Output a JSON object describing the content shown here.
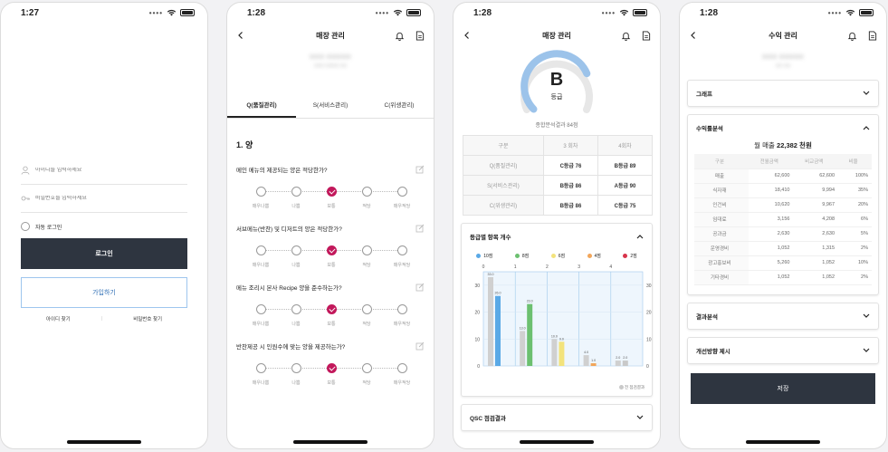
{
  "status": {
    "time1": "1:27",
    "time2": "1:28",
    "time3": "1:28",
    "time4": "1:28"
  },
  "login": {
    "id_placeholder": "아이디를 입력하세요",
    "pw_placeholder": "비밀번호를 입력하세요",
    "auto_login": "자동 로그인",
    "login_btn": "로그인",
    "join_btn": "가입하기",
    "find_id": "아이디 찾기",
    "sep": "|",
    "find_pw": "비밀번호 찾기"
  },
  "store": {
    "title": "매장 관리",
    "store_name": "○○○ ○○○○○",
    "store_sub": "○○○ ○○○○ ○○",
    "tabs": [
      "Q(품질관리)",
      "S(서비스관리)",
      "C(위생관리)"
    ],
    "section": "1. 양",
    "questions": [
      {
        "text": "메인 메뉴의 제공되는 양은 적당한가?",
        "selected": 2
      },
      {
        "text": "서브메뉴(반찬) 및 디저트의 양은 적당한가?",
        "selected": 2
      },
      {
        "text": "메뉴 조리시 본사 Recipe 양을 준수하는가?",
        "selected": 2
      },
      {
        "text": "반찬제공 시 인원수에 맞는 양을 제공하는가?",
        "selected": 2
      }
    ],
    "scale_labels": [
      "매우나쁨",
      "나쁨",
      "보통",
      "적당",
      "매우적당"
    ]
  },
  "analysis": {
    "title": "매장 관리",
    "grade": "B",
    "grade_label": "등급",
    "gauge_fraction": 0.75,
    "summary": "종합분석결과 84점",
    "table_head": [
      "구분",
      "3 회차",
      "4회차"
    ],
    "table_rows": [
      {
        "cat": "Q(품질관리)",
        "r3": "C등급 76",
        "r4": "B등급 89"
      },
      {
        "cat": "S(서비스관리)",
        "r3": "B등급 86",
        "r4": "A등급 90"
      },
      {
        "cat": "C(위생관리)",
        "r3": "B등급 86",
        "r4": "C등급 75"
      }
    ],
    "card_title": "등급별 항목 개수",
    "legend": [
      {
        "label": "10점",
        "color": "#5aa9e6"
      },
      {
        "label": "8점",
        "color": "#6cc070"
      },
      {
        "label": "6점",
        "color": "#f3e37c"
      },
      {
        "label": "4점",
        "color": "#f2a65a"
      },
      {
        "label": "2점",
        "color": "#d8344c"
      }
    ],
    "chart_note": "전 점검결과",
    "next_card": "QSC 점검결과"
  },
  "chart_data": {
    "type": "bar",
    "categories": [
      "10점",
      "8점",
      "6점",
      "4점",
      "2점"
    ],
    "top_ticks": [
      "0",
      "1",
      "2",
      "3",
      "4"
    ],
    "series": [
      {
        "name": "전 점검결과",
        "values": [
          33.0,
          13.0,
          10.0,
          4.0,
          2.0
        ]
      },
      {
        "values": [
          26.0,
          23.0,
          9.0,
          1.0,
          2.0
        ]
      }
    ],
    "series_colors": [
      "#d0d0d0",
      [
        "#5aa9e6",
        "#6cc070",
        "#f3e37c",
        "#f2a65a",
        "#c9c9c9"
      ]
    ],
    "yticks": [
      "0",
      "10",
      "20",
      "30"
    ],
    "ylim": [
      0,
      35
    ]
  },
  "profit": {
    "title": "수익 관리",
    "store_name": "○○○ ○○○○○",
    "store_sub": "○○ ○○",
    "sec_graph": "그래프",
    "sec_profit": "수익률분석",
    "monthly_label": "월 매출",
    "monthly_value": "22,382 천원",
    "head": [
      "구분",
      "전월금액",
      "비교금액",
      "비율"
    ],
    "rows": [
      {
        "n": "매출",
        "a": "62,600",
        "b": "62,600",
        "c": "100%"
      },
      {
        "n": "식자재",
        "a": "18,410",
        "b": "9,994",
        "c": "35%"
      },
      {
        "n": "인건비",
        "a": "10,620",
        "b": "9,967",
        "c": "20%"
      },
      {
        "n": "임대료",
        "a": "3,156",
        "b": "4,208",
        "c": "6%"
      },
      {
        "n": "공과금",
        "a": "2,630",
        "b": "2,630",
        "c": "5%"
      },
      {
        "n": "운영경비",
        "a": "1,052",
        "b": "1,315",
        "c": "2%"
      },
      {
        "n": "광고홍보비",
        "a": "5,260",
        "b": "1,052",
        "c": "10%"
      },
      {
        "n": "기타경비",
        "a": "1,052",
        "b": "1,052",
        "c": "2%"
      }
    ],
    "sec_result": "결과분석",
    "sec_improve": "개선방향 제시",
    "save": "저장"
  }
}
